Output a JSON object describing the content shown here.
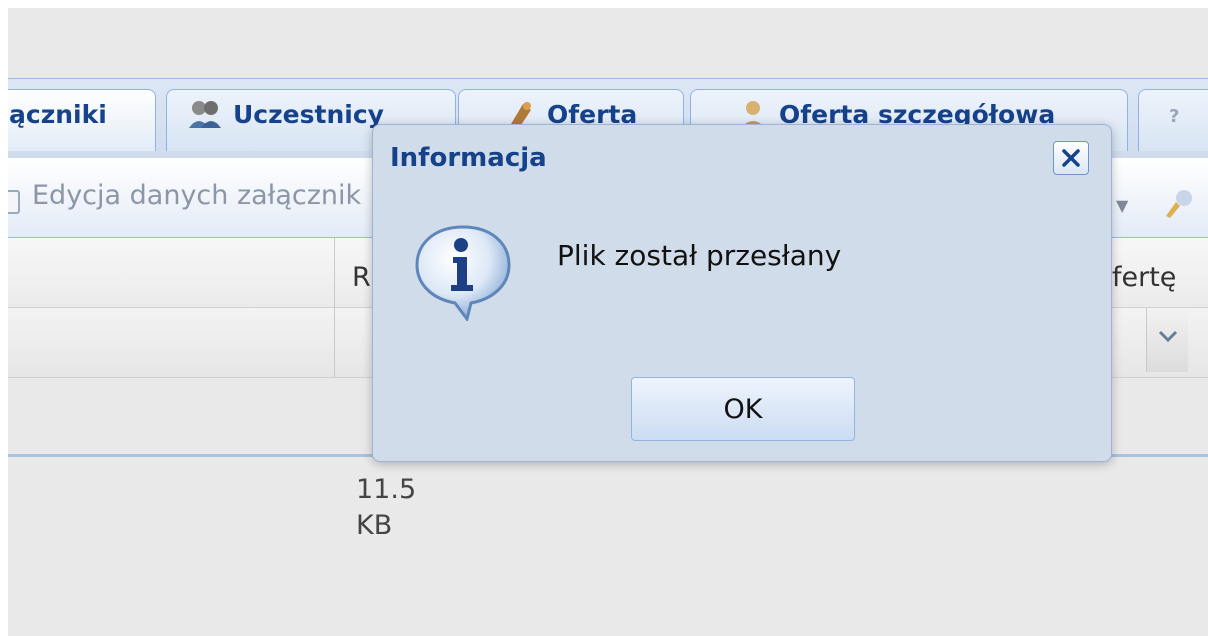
{
  "tabs": [
    {
      "label": "ączniki",
      "icon": "attachment-icon",
      "active": true
    },
    {
      "label": "Uczestnicy",
      "icon": "participants-icon",
      "active": false
    },
    {
      "label": "Oferta",
      "icon": "offer-icon",
      "active": false
    },
    {
      "label": "Oferta szczegółowa",
      "icon": "detailed-offer-icon",
      "active": false
    },
    {
      "label": "?",
      "icon": "help-icon",
      "active": false
    }
  ],
  "toolbar": {
    "edit_label": "Edycja danych załącznik"
  },
  "grid": {
    "header_partial_left": "R",
    "header_partial_right": "fertę",
    "size_value": "11.5",
    "size_unit": "KB"
  },
  "dialog": {
    "title": "Informacja",
    "message": "Plik został przesłany",
    "ok_label": "OK"
  },
  "colors": {
    "title_blue": "#15428b",
    "dialog_bg": "#d1dcea",
    "border_blue": "#99bbe8"
  }
}
